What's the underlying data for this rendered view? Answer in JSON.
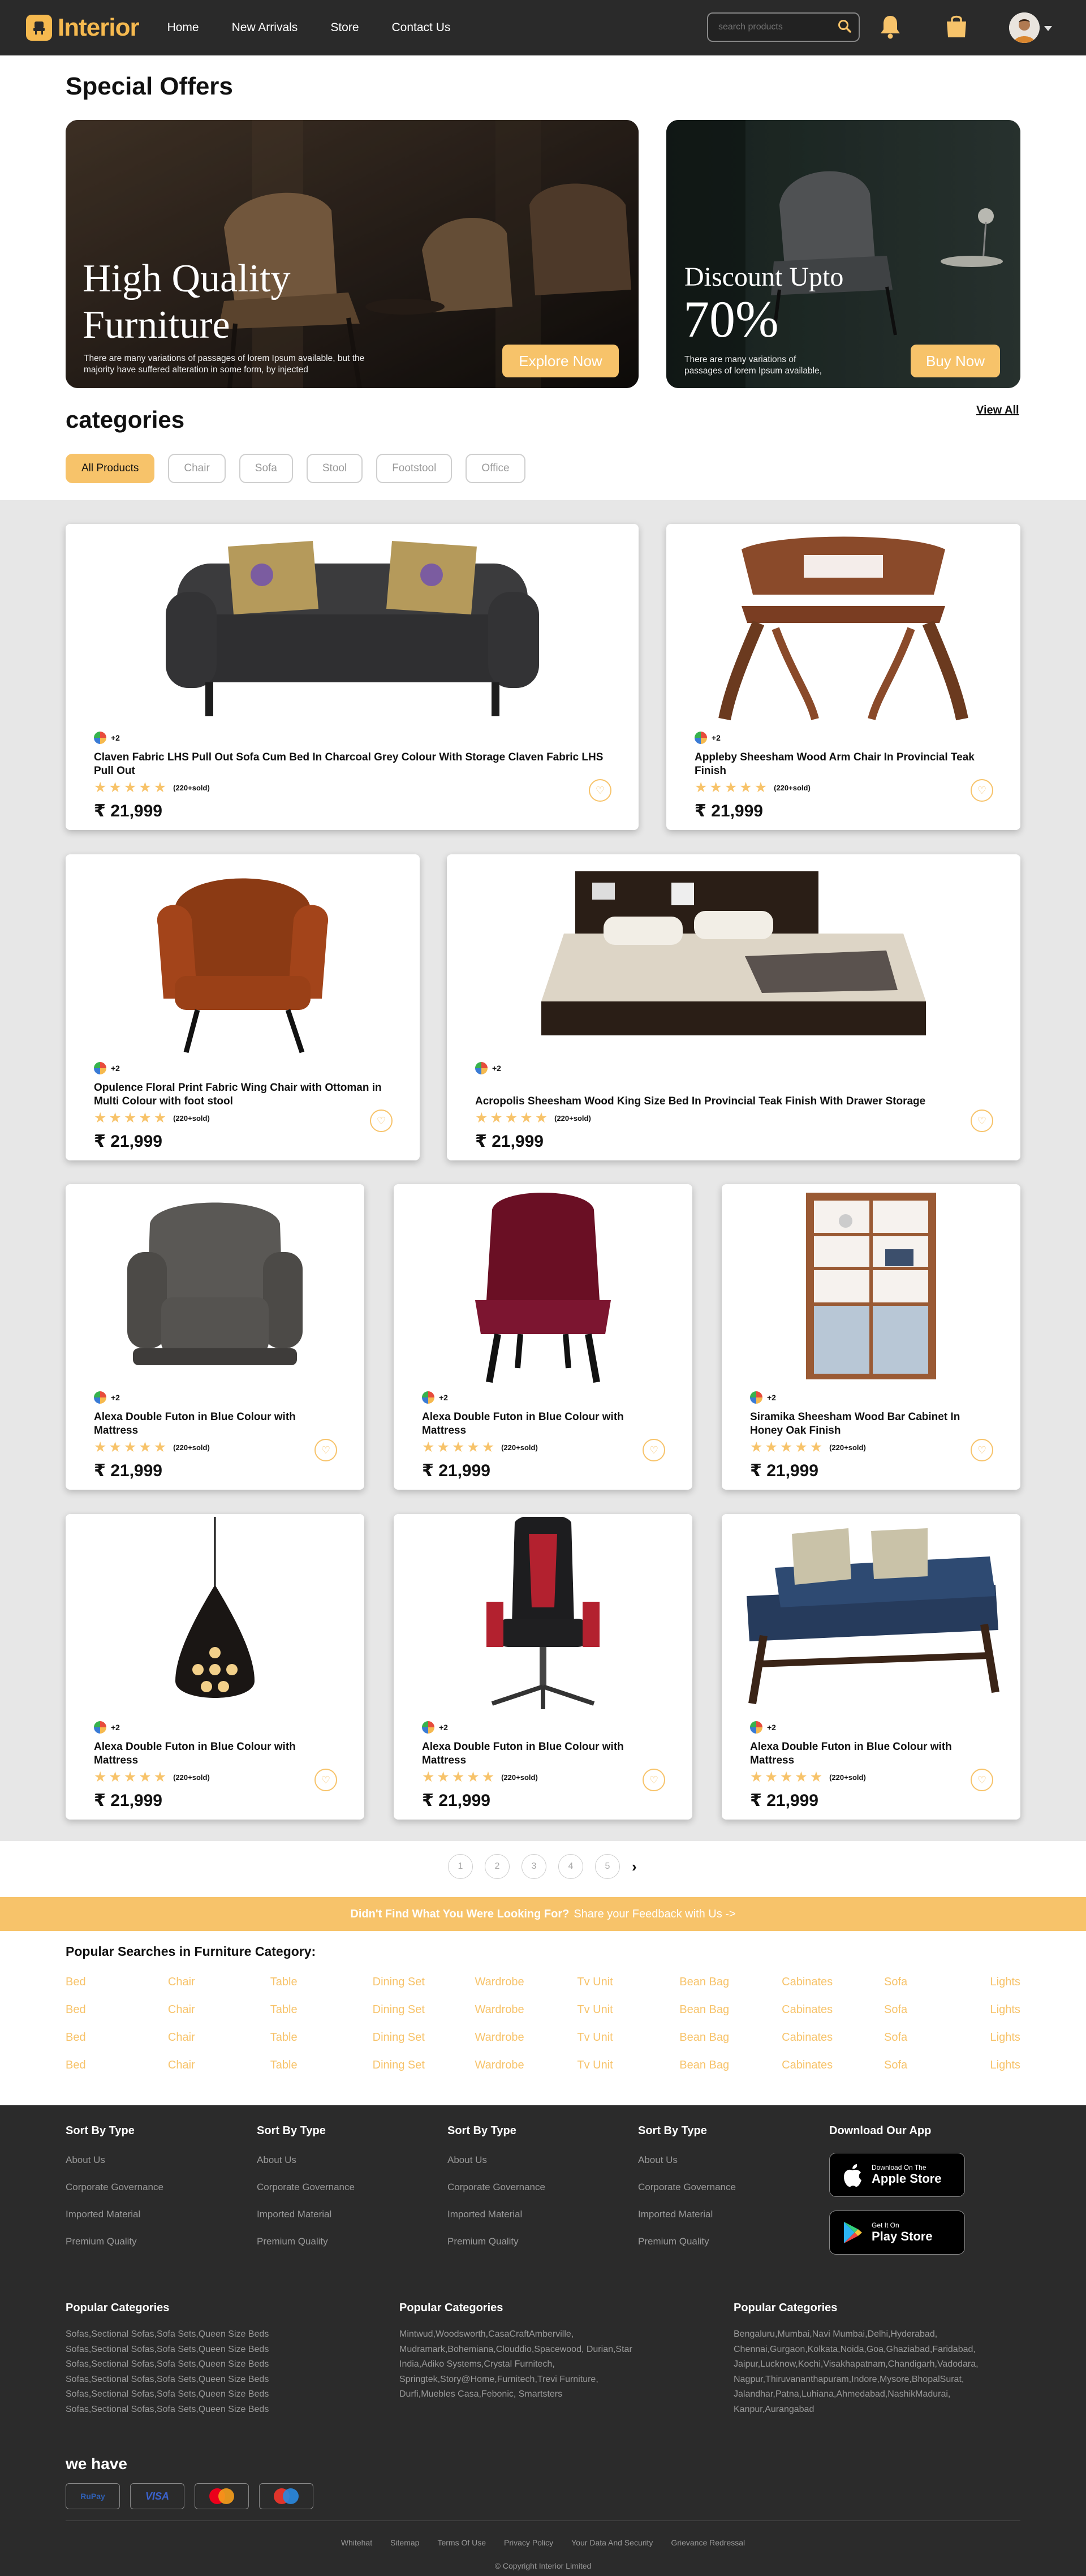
{
  "brand": {
    "name": "Interior"
  },
  "nav": [
    {
      "label": "Home"
    },
    {
      "label": "New Arrivals"
    },
    {
      "label": "Store"
    },
    {
      "label": "Contact Us"
    }
  ],
  "search": {
    "placeholder": "search products"
  },
  "special": {
    "title": "Special Offers",
    "banner1": {
      "heading": "High Quality Furniture",
      "text": "There are many variations of passages of lorem Ipsum available, but the majority have suffered alteration in some form, by injected",
      "button": "Explore Now"
    },
    "banner2": {
      "heading": "Discount Upto",
      "percent": "70%",
      "text": "There are many variations of passages of lorem Ipsum available,",
      "button": "Buy Now"
    }
  },
  "categories": {
    "title": "categories",
    "view_all": "View All",
    "filters": [
      {
        "label": "All Products"
      },
      {
        "label": "Chair"
      },
      {
        "label": "Sofa"
      },
      {
        "label": "Stool"
      },
      {
        "label": "Footstool"
      },
      {
        "label": "Office"
      }
    ]
  },
  "products": [
    {
      "name": "Claven Fabric LHS Pull Out Sofa Cum Bed In Charcoal Grey Colour With Storage Claven Fabric LHS Pull Out",
      "colors_more": "+2",
      "sold": "(220+sold)",
      "price": "₹ 21,999",
      "image": "sofa"
    },
    {
      "name": "Appleby Sheesham Wood Arm Chair In Provincial Teak Finish",
      "colors_more": "+2",
      "sold": "(220+sold)",
      "price": "₹ 21,999",
      "image": "wood-chair"
    },
    {
      "name": "Opulence Floral Print Fabric Wing Chair with Ottoman in Multi Colour with foot stool",
      "colors_more": "+2",
      "sold": "(220+sold)",
      "price": "₹ 21,999",
      "image": "wing-chair"
    },
    {
      "name": "Acropolis Sheesham Wood King Size Bed In Provincial Teak Finish With Drawer Storage",
      "colors_more": "+2",
      "sold": "(220+sold)",
      "price": "₹ 21,999",
      "image": "bed"
    },
    {
      "name": "Alexa Double Futon in Blue Colour with Mattress",
      "colors_more": "+2",
      "sold": "(220+sold)",
      "price": "₹ 21,999",
      "image": "recliner"
    },
    {
      "name": "Alexa Double Futon in Blue Colour with Mattress",
      "colors_more": "+2",
      "sold": "(220+sold)",
      "price": "₹ 21,999",
      "image": "velvet-chair"
    },
    {
      "name": "Siramika Sheesham Wood Bar Cabinet In Honey Oak Finish",
      "colors_more": "+2",
      "sold": "(220+sold)",
      "price": "₹ 21,999",
      "image": "cabinet"
    },
    {
      "name": "Alexa Double Futon in Blue Colour with Mattress",
      "colors_more": "+2",
      "sold": "(220+sold)",
      "price": "₹ 21,999",
      "image": "lamp"
    },
    {
      "name": "Alexa Double Futon in Blue Colour with Mattress",
      "colors_more": "+2",
      "sold": "(220+sold)",
      "price": "₹ 21,999",
      "image": "gaming-chair"
    },
    {
      "name": "Alexa Double Futon in Blue Colour with Mattress",
      "colors_more": "+2",
      "sold": "(220+sold)",
      "price": "₹ 21,999",
      "image": "futon"
    }
  ],
  "rating": {
    "stars": 5
  },
  "pagination": [
    "1",
    "2",
    "3",
    "4",
    "5"
  ],
  "feedback": {
    "question": "Didn't Find What You Were Looking For?",
    "cta": "Share your Feedback with Us ->"
  },
  "popular_searches": {
    "title": "Popular Searches in Furniture Category:",
    "items": [
      "Bed",
      "Chair",
      "Table",
      "Dining Set",
      "Wardrobe",
      "Tv Unit",
      "Bean Bag",
      "Cabinates",
      "Sofa",
      "Lights"
    ]
  },
  "footer": {
    "col_title": "Sort By Type",
    "links": [
      "About Us",
      "Corporate Governance",
      "Imported Material",
      "Premium Quality"
    ],
    "app": {
      "title": "Download Our App",
      "apple_small": "Download On The",
      "apple": "Apple Store",
      "play_small": "Get It On",
      "play": "Play Store"
    },
    "popular_title": "Popular Categories",
    "pc1": "Sofas,Sectional Sofas,Sofa Sets,Queen Size Beds Sofas,Sectional Sofas,Sofa Sets,Queen Size Beds Sofas,Sectional Sofas,Sofa Sets,Queen Size Beds Sofas,Sectional Sofas,Sofa Sets,Queen Size Beds Sofas,Sectional Sofas,Sofa Sets,Queen Size Beds Sofas,Sectional Sofas,Sofa Sets,Queen Size Beds",
    "pc2": "Mintwud,Woodsworth,CasaCraftAmberville, Mudramark,Bohemiana,Clouddio,Spacewood, Durian,Star India,Adiko Systems,Crystal Furnitech, Springtek,Story@Home,Furnitech,Trevi Furniture, Durfi,Muebles Casa,Febonic, Smartsters",
    "pc3": "Bengaluru,Mumbai,Navi Mumbai,Delhi,Hyderabad, Chennai,Gurgaon,Kolkata,Noida,Goa,Ghaziabad,Faridabad, Jaipur,Lucknow,Kochi,Visakhapatnam,Chandigarh,Vadodara, Nagpur,Thiruvananthapuram,Indore,Mysore,BhopalSurat, Jalandhar,Patna,Luhiana,Ahmedabad,NashikMadurai, Kanpur,Aurangabad",
    "we_have": "we have",
    "payments": [
      "RuPay",
      "VISA",
      "MasterCard",
      "Maestro"
    ],
    "bottom_links": [
      "Whitehat",
      "Sitemap",
      "Terms Of Use",
      "Privacy Policy",
      "Your Data And Security",
      "Grievance Redressal"
    ],
    "copyright": "© Copyright Interior Limited"
  },
  "colors": {
    "accent": "#f7c36a",
    "header": "#2a2a2a",
    "footer": "#2b2b2b",
    "grid_bg": "#e7e7e7"
  }
}
